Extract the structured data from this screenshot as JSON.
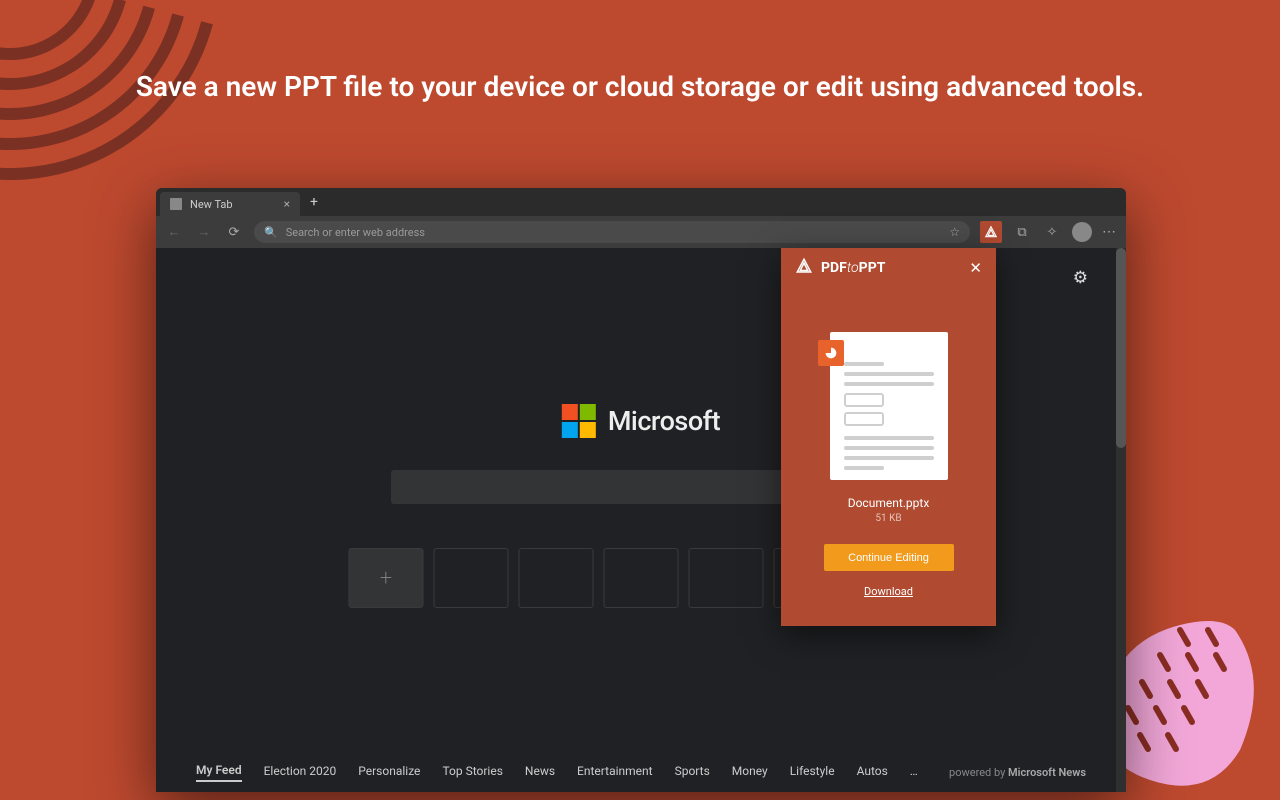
{
  "headline": "Save a new PPT file to your device or cloud storage or edit using advanced tools.",
  "browser": {
    "tab": {
      "title": "New Tab"
    },
    "omnibox": {
      "placeholder": "Search or enter web address"
    },
    "brand": "Microsoft",
    "feed": {
      "items": [
        "My Feed",
        "Election 2020",
        "Personalize",
        "Top Stories",
        "News",
        "Entertainment",
        "Sports",
        "Money",
        "Lifestyle",
        "Autos",
        "…"
      ],
      "active_index": 0,
      "powered_by_label": "powered by",
      "powered_by_name": "Microsoft News"
    }
  },
  "popup": {
    "title_prefix": "PDF",
    "title_mid": "to",
    "title_suffix": "PPT",
    "filename": "Document.pptx",
    "filesize": "51 KB",
    "continue_label": "Continue Editing",
    "download_label": "Download"
  }
}
